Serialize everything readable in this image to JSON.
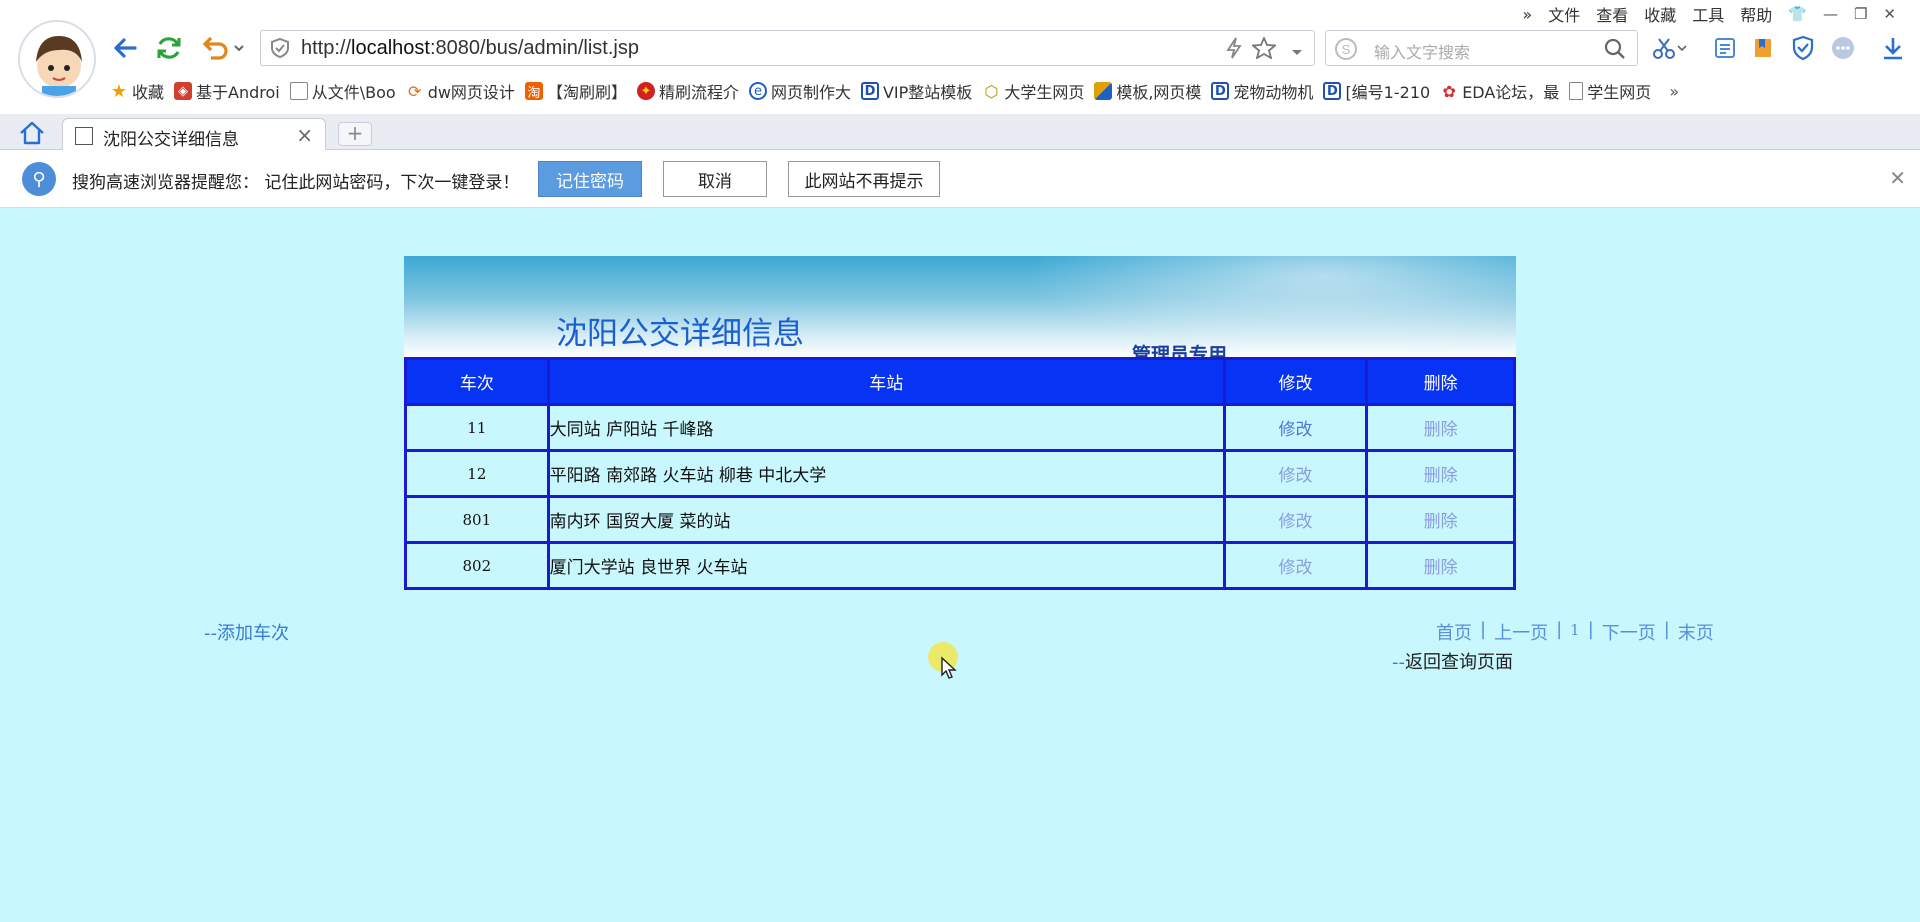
{
  "browser": {
    "top_menu": [
      "文件",
      "查看",
      "收藏",
      "工具",
      "帮助"
    ],
    "url": {
      "prefix": "http://",
      "host": "localhost",
      "rest": ":8080/bus/admin/list.jsp"
    },
    "search_placeholder": "输入文字搜索",
    "bookmarks": [
      {
        "label": "收藏",
        "icon": "star-icon",
        "color": "#f0a000"
      },
      {
        "label": "基于Androi",
        "icon": "app-icon",
        "color": "#d04030"
      },
      {
        "label": "从文件\\Boo",
        "icon": "folder-icon",
        "color": "#888888"
      },
      {
        "label": "dw网页设计",
        "icon": "swirl-icon",
        "color": "#e07020"
      },
      {
        "label": "【淘刷刷】",
        "icon": "tao-icon",
        "color": "#f06000"
      },
      {
        "label": "精刷流程介",
        "icon": "badge-icon",
        "color": "#d02020"
      },
      {
        "label": "网页制作大",
        "icon": "globe-icon",
        "color": "#2060c0"
      },
      {
        "label": "VIP整站模板",
        "icon": "d-icon",
        "color": "#2050b0"
      },
      {
        "label": "大学生网页",
        "icon": "hex-icon",
        "color": "#c09000"
      },
      {
        "label": "模板,网页模",
        "icon": "tile-icon",
        "color": "#e0a000"
      },
      {
        "label": "宠物动物机",
        "icon": "d-icon",
        "color": "#2050b0"
      },
      {
        "label": "[编号1-210",
        "icon": "d-icon",
        "color": "#2050b0"
      },
      {
        "label": "EDA论坛，最",
        "icon": "eda-icon",
        "color": "#d03030"
      },
      {
        "label": "学生网页",
        "icon": "page-icon",
        "color": "#888888"
      }
    ],
    "tab_title": "沈阳公交详细信息"
  },
  "notification": {
    "message": "搜狗高速浏览器提醒您： 记住此网站密码，下次一键登录！",
    "remember_label": "记住密码",
    "cancel_label": "取消",
    "never_label": "此网站不再提示"
  },
  "page": {
    "title": "沈阳公交详细信息",
    "admin_label": "管理员专用",
    "table": {
      "headers": [
        "车次",
        "车站",
        "修改",
        "删除"
      ],
      "rows": [
        {
          "num": "11",
          "stations": "大同站 庐阳站 千峰路",
          "edit": "修改",
          "delete": "删除"
        },
        {
          "num": "12",
          "stations": "平阳路 南郊路 火车站 柳巷 中北大学",
          "edit": "修改",
          "delete": "删除"
        },
        {
          "num": "801",
          "stations": "南内环 国贸大厦 菜的站",
          "edit": "修改",
          "delete": "删除"
        },
        {
          "num": "802",
          "stations": "厦门大学站 良世界 火车站",
          "edit": "修改",
          "delete": "删除"
        }
      ]
    },
    "add_link": "--添加车次",
    "pager": {
      "first": "首页",
      "prev": "上一页",
      "current": "1",
      "next": "下一页",
      "last": "末页"
    },
    "back_link_dash": "--",
    "back_link_text": "返回查询页面"
  }
}
